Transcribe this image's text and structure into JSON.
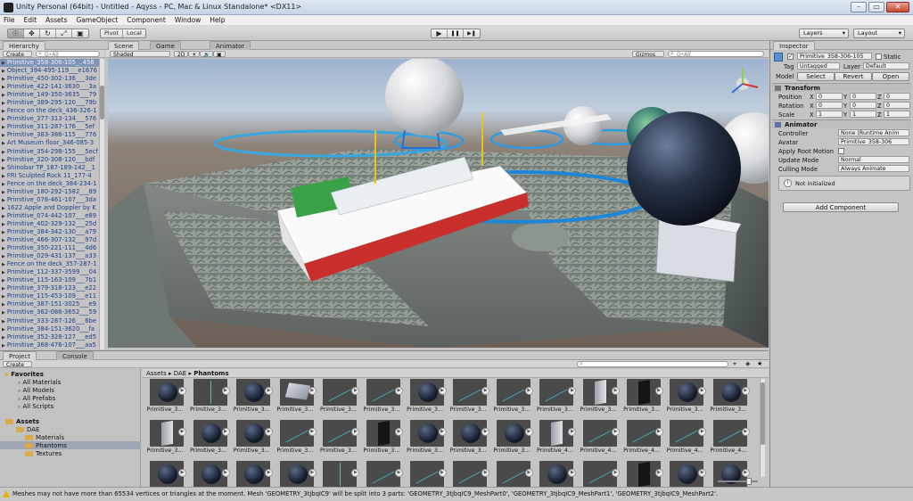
{
  "window": {
    "title": "Unity Personal (64bit) - Untitled - Aqyss - PC, Mac & Linux Standalone* <DX11>",
    "controls": [
      "–",
      "▭",
      "✕"
    ]
  },
  "menu": [
    "File",
    "Edit",
    "Assets",
    "GameObject",
    "Component",
    "Window",
    "Help"
  ],
  "toolbar": {
    "tools": [
      "☉",
      "✥",
      "↻",
      "⤢",
      "▣"
    ],
    "pivot": "Pivot",
    "local": "Local",
    "play": "▶",
    "pause": "❚❚",
    "step": "▶❚",
    "layers": "Layers",
    "layout": "Layout"
  },
  "hierarchy": {
    "tab": "Hierarchy",
    "create": "Create",
    "search": "G•All",
    "items": [
      "Primitive_358-306-105_..456",
      "Object_394-495-119___e1676",
      "Primitive_450-302-136___3de",
      "Primitive_422-141-3630___3a",
      "Primitive_149-350-3635___79",
      "Primitive_389-295-120___79b",
      "Fence on the deck_436-326-1",
      "Primitive_377-313-134___576",
      "Primitive_311-287-176___5ef",
      "Primitive_383-386-115___776",
      "Art Museum floor_346-085-3",
      "Primitive_354-298-155___5ecf",
      "Primitive_320-308-120___bdf",
      "Shinobar TP_187-189-142__1",
      "FRI Sculpted Rock 11_177-4",
      "Fence on the deck_384-234-1",
      "Primitive_180-292-1582___89",
      "Primitive_076-461-107___3da",
      "1622 Apple and Doppler by K",
      "Primitive_074-442-107___e89",
      "Primitive_402-329-132___25d",
      "Primitive_384-342-130___a79",
      "Primitive_466-307-132___97d",
      "Primitive_350-221-111___4d6",
      "Primitive_029-431-137___a33",
      "Fence on the deck_357-287-1",
      "Primitive_112-337-3599___04",
      "Primitive_115-163-109___7b1",
      "Primitive_379-318-123___e22",
      "Primitive_115-453-109___e11",
      "Primitive_387-151-3025___e9",
      "Primitive_362-086-3652___59",
      "Primitive_333-287-126___6be",
      "Primitive_384-151-3620___fa",
      "Primitive_352-328-127___ed5",
      "Primitive_368-476-107___aa5"
    ]
  },
  "scene": {
    "tabs": [
      "Scene",
      "Game",
      "Animator"
    ],
    "shading": "Shaded",
    "mode_2d": "2D",
    "gizmos": "Gizmos",
    "search": "G•All",
    "icons": [
      "☀",
      "🔊",
      "▣"
    ]
  },
  "inspector": {
    "tab": "Inspector",
    "object_name": "Primitive_358-306-105__",
    "static_label": "Static",
    "tag_label": "Tag",
    "tag_value": "Untagged",
    "layer_label": "Layer",
    "layer_value": "Default",
    "model_label": "Model",
    "model_buttons": [
      "Select",
      "Revert",
      "Open"
    ],
    "transform": {
      "title": "Transform",
      "rows": [
        {
          "label": "Position",
          "x": "0",
          "y": "0",
          "z": "0"
        },
        {
          "label": "Rotation",
          "x": "0",
          "y": "0",
          "z": "0"
        },
        {
          "label": "Scale",
          "x": "1",
          "y": "1",
          "z": "1"
        }
      ]
    },
    "animator": {
      "title": "Animator",
      "controller_label": "Controller",
      "controller_value": "None (Runtime Anim",
      "avatar_label": "Avatar",
      "avatar_value": "Primitive_358-306",
      "root_motion_label": "Apply Root Motion",
      "update_mode_label": "Update Mode",
      "update_mode_value": "Normal",
      "culling_mode_label": "Culling Mode",
      "culling_mode_value": "Always Animate",
      "info": "Not initialized"
    },
    "add_component": "Add Component"
  },
  "project": {
    "tabs": [
      "Project",
      "Console"
    ],
    "create": "Create",
    "favorites_title": "Favorites",
    "favorites": [
      "All Materials",
      "All Models",
      "All Prefabs",
      "All Scripts"
    ],
    "assets_title": "Assets",
    "tree": [
      "DAE",
      "Materials",
      "Phantoms",
      "Textures"
    ],
    "breadcrumb": [
      "Assets",
      "DAE",
      "Phantoms"
    ],
    "search": "",
    "row1_labels": [
      "Primitive_3...",
      "Primitive_3...",
      "Primitive_3...",
      "Primitive_3...",
      "Primitive_3...",
      "Primitive_3...",
      "Primitive_3...",
      "Primitive_3...",
      "Primitive_3...",
      "Primitive_3...",
      "Primitive_3...",
      "Primitive_3...",
      "Primitive_3...",
      "Primitive_3..."
    ],
    "row2_labels": [
      "Primitive_3...",
      "Primitive_3...",
      "Primitive_3...",
      "Primitive_3...",
      "Primitive_3...",
      "Primitive_3...",
      "Primitive_3...",
      "Primitive_3...",
      "Primitive_3...",
      "Primitive_4...",
      "Primitive_4...",
      "Primitive_4...",
      "Primitive_4...",
      "Primitive_4..."
    ]
  },
  "status": {
    "message": "Meshes may not have more than 65534 vertices or triangles at the moment. Mesh 'GEOMETRY_3tjbqIC9' will be split into 3 parts: 'GEOMETRY_3tjbqIC9_MeshPart0', 'GEOMETRY_3tjbqIC9_MeshPart1', 'GEOMETRY_3tjbqIC9_MeshPart2'."
  }
}
